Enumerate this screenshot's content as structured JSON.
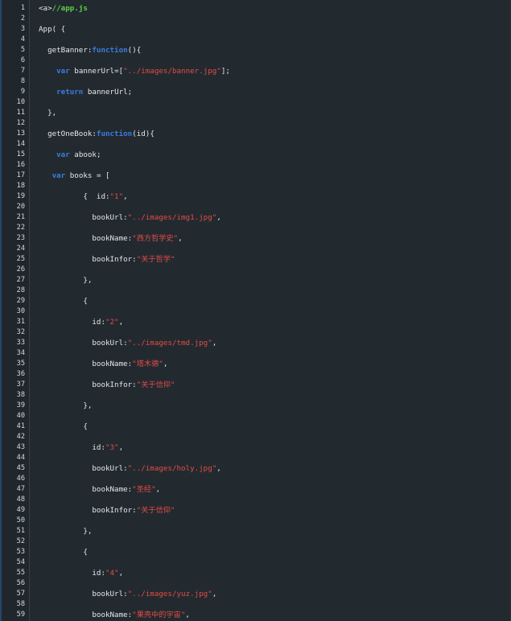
{
  "editor": {
    "lines": [
      {
        "n": "1",
        "tokens": [
          {
            "t": "<a>",
            "k": "plain"
          },
          {
            "t": "//app.js",
            "k": "comment"
          }
        ]
      },
      {
        "n": "2",
        "tokens": []
      },
      {
        "n": "3",
        "tokens": [
          {
            "t": "App( {",
            "k": "plain"
          }
        ]
      },
      {
        "n": "4",
        "tokens": []
      },
      {
        "n": "5",
        "tokens": [
          {
            "t": "  getBanner:",
            "k": "plain"
          },
          {
            "t": "function",
            "k": "kw"
          },
          {
            "t": "(){",
            "k": "plain"
          }
        ]
      },
      {
        "n": "6",
        "tokens": []
      },
      {
        "n": "7",
        "tokens": [
          {
            "t": "    ",
            "k": "plain"
          },
          {
            "t": "var",
            "k": "kw"
          },
          {
            "t": " bannerUrl=[",
            "k": "plain"
          },
          {
            "t": "\"../images/banner.jpg\"",
            "k": "str"
          },
          {
            "t": "];",
            "k": "plain"
          }
        ]
      },
      {
        "n": "8",
        "tokens": []
      },
      {
        "n": "9",
        "tokens": [
          {
            "t": "    ",
            "k": "plain"
          },
          {
            "t": "return",
            "k": "kw"
          },
          {
            "t": " bannerUrl;",
            "k": "plain"
          }
        ]
      },
      {
        "n": "10",
        "tokens": []
      },
      {
        "n": "11",
        "tokens": [
          {
            "t": "  },",
            "k": "plain"
          }
        ]
      },
      {
        "n": "12",
        "tokens": []
      },
      {
        "n": "13",
        "tokens": [
          {
            "t": "  getOneBook:",
            "k": "plain"
          },
          {
            "t": "function",
            "k": "kw"
          },
          {
            "t": "(id){",
            "k": "plain"
          }
        ]
      },
      {
        "n": "14",
        "tokens": []
      },
      {
        "n": "15",
        "tokens": [
          {
            "t": "    ",
            "k": "plain"
          },
          {
            "t": "var",
            "k": "kw"
          },
          {
            "t": " abook;",
            "k": "plain"
          }
        ]
      },
      {
        "n": "16",
        "tokens": []
      },
      {
        "n": "17",
        "tokens": [
          {
            "t": "   ",
            "k": "plain"
          },
          {
            "t": "var",
            "k": "kw"
          },
          {
            "t": " books = [",
            "k": "plain"
          }
        ]
      },
      {
        "n": "18",
        "tokens": []
      },
      {
        "n": "19",
        "tokens": [
          {
            "t": "          {  id:",
            "k": "plain"
          },
          {
            "t": "\"1\"",
            "k": "str"
          },
          {
            "t": ",",
            "k": "plain"
          }
        ]
      },
      {
        "n": "20",
        "tokens": []
      },
      {
        "n": "21",
        "tokens": [
          {
            "t": "            bookUrl:",
            "k": "plain"
          },
          {
            "t": "\"../images/img1.jpg\"",
            "k": "str"
          },
          {
            "t": ",",
            "k": "plain"
          }
        ]
      },
      {
        "n": "22",
        "tokens": []
      },
      {
        "n": "23",
        "tokens": [
          {
            "t": "            bookName:",
            "k": "plain"
          },
          {
            "t": "\"西方哲学史\"",
            "k": "str"
          },
          {
            "t": ",",
            "k": "plain"
          }
        ]
      },
      {
        "n": "24",
        "tokens": []
      },
      {
        "n": "25",
        "tokens": [
          {
            "t": "            bookInfor:",
            "k": "plain"
          },
          {
            "t": "\"关于哲学\"",
            "k": "str"
          }
        ]
      },
      {
        "n": "26",
        "tokens": []
      },
      {
        "n": "27",
        "tokens": [
          {
            "t": "          },",
            "k": "plain"
          }
        ]
      },
      {
        "n": "28",
        "tokens": []
      },
      {
        "n": "29",
        "tokens": [
          {
            "t": "          {",
            "k": "plain"
          }
        ]
      },
      {
        "n": "30",
        "tokens": []
      },
      {
        "n": "31",
        "tokens": [
          {
            "t": "            id:",
            "k": "plain"
          },
          {
            "t": "\"2\"",
            "k": "str"
          },
          {
            "t": ",",
            "k": "plain"
          }
        ]
      },
      {
        "n": "32",
        "tokens": []
      },
      {
        "n": "33",
        "tokens": [
          {
            "t": "            bookUrl:",
            "k": "plain"
          },
          {
            "t": "\"../images/tmd.jpg\"",
            "k": "str"
          },
          {
            "t": ",",
            "k": "plain"
          }
        ]
      },
      {
        "n": "34",
        "tokens": []
      },
      {
        "n": "35",
        "tokens": [
          {
            "t": "            bookName:",
            "k": "plain"
          },
          {
            "t": "\"塔木德\"",
            "k": "str"
          },
          {
            "t": ",",
            "k": "plain"
          }
        ]
      },
      {
        "n": "36",
        "tokens": []
      },
      {
        "n": "37",
        "tokens": [
          {
            "t": "            bookInfor:",
            "k": "plain"
          },
          {
            "t": "\"关于信仰\"",
            "k": "str"
          }
        ]
      },
      {
        "n": "38",
        "tokens": []
      },
      {
        "n": "39",
        "tokens": [
          {
            "t": "          },",
            "k": "plain"
          }
        ]
      },
      {
        "n": "40",
        "tokens": []
      },
      {
        "n": "41",
        "tokens": [
          {
            "t": "          {",
            "k": "plain"
          }
        ]
      },
      {
        "n": "42",
        "tokens": []
      },
      {
        "n": "43",
        "tokens": [
          {
            "t": "            id:",
            "k": "plain"
          },
          {
            "t": "\"3\"",
            "k": "str"
          },
          {
            "t": ",",
            "k": "plain"
          }
        ]
      },
      {
        "n": "44",
        "tokens": []
      },
      {
        "n": "45",
        "tokens": [
          {
            "t": "            bookUrl:",
            "k": "plain"
          },
          {
            "t": "\"../images/holy.jpg\"",
            "k": "str"
          },
          {
            "t": ",",
            "k": "plain"
          }
        ]
      },
      {
        "n": "46",
        "tokens": []
      },
      {
        "n": "47",
        "tokens": [
          {
            "t": "            bookName:",
            "k": "plain"
          },
          {
            "t": "\"圣经\"",
            "k": "str"
          },
          {
            "t": ",",
            "k": "plain"
          }
        ]
      },
      {
        "n": "48",
        "tokens": []
      },
      {
        "n": "49",
        "tokens": [
          {
            "t": "            bookInfor:",
            "k": "plain"
          },
          {
            "t": "\"关于信仰\"",
            "k": "str"
          }
        ]
      },
      {
        "n": "50",
        "tokens": []
      },
      {
        "n": "51",
        "tokens": [
          {
            "t": "          },",
            "k": "plain"
          }
        ]
      },
      {
        "n": "52",
        "tokens": []
      },
      {
        "n": "53",
        "tokens": [
          {
            "t": "          {",
            "k": "plain"
          }
        ]
      },
      {
        "n": "54",
        "tokens": []
      },
      {
        "n": "55",
        "tokens": [
          {
            "t": "            id:",
            "k": "plain"
          },
          {
            "t": "\"4\"",
            "k": "str"
          },
          {
            "t": ",",
            "k": "plain"
          }
        ]
      },
      {
        "n": "56",
        "tokens": []
      },
      {
        "n": "57",
        "tokens": [
          {
            "t": "            bookUrl:",
            "k": "plain"
          },
          {
            "t": "\"../images/yuz.jpg\"",
            "k": "str"
          },
          {
            "t": ",",
            "k": "plain"
          }
        ]
      },
      {
        "n": "58",
        "tokens": []
      },
      {
        "n": "59",
        "tokens": [
          {
            "t": "            bookName:",
            "k": "plain"
          },
          {
            "t": "\"果壳中的宇宙\"",
            "k": "str"
          },
          {
            "t": ",",
            "k": "plain"
          }
        ]
      }
    ]
  },
  "colors": {
    "background": "#222a30",
    "gutter": "#1f272c",
    "keyword": "#3b7ce0",
    "string": "#e54b44",
    "comment": "#5fd043",
    "text": "#e4e7ea"
  }
}
